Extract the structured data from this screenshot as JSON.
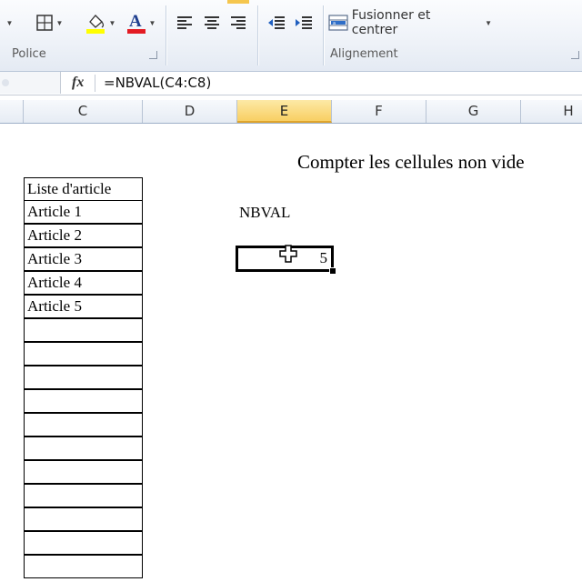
{
  "ribbon": {
    "groups": {
      "police_label": "Police",
      "alignement_label": "Alignement"
    },
    "buttons": {
      "fusionner_label": "Fusionner et centrer"
    },
    "colors": {
      "fill_color": "#FFFF00",
      "font_color": "#E31B23"
    }
  },
  "formula_bar": {
    "fx_label": "fx",
    "formula": "=NBVAL(C4:C8)"
  },
  "columns": [
    "C",
    "D",
    "E",
    "F",
    "G",
    "H"
  ],
  "active_column": "E",
  "sheet": {
    "title": "Compter les cellules non vide",
    "list_header": "Liste d'article",
    "list_items": [
      "Article 1",
      "Article 2",
      "Article 3",
      "Article 4",
      "Article 5",
      "",
      "",
      "",
      "",
      "",
      "",
      "",
      "",
      "",
      "",
      ""
    ],
    "nbval_label": "NBVAL",
    "nbval_result": "5"
  }
}
